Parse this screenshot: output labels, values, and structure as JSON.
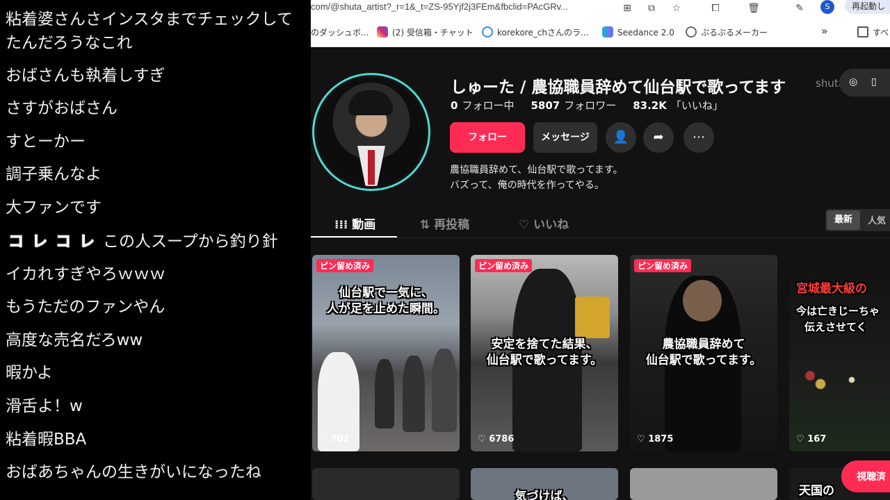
{
  "comments": [
    {
      "text": "粘着婆さんさインスタまでチェックして"
    },
    {
      "text": "たんだろうなこれ"
    },
    {
      "text": "おばさんも執着しすぎ"
    },
    {
      "text": "さすがおばさん"
    },
    {
      "text": "すとーかー"
    },
    {
      "text": "調子乗んなよ"
    },
    {
      "text": "大ファンです"
    },
    {
      "text": "この人スープから釣り針"
    },
    {
      "text": "イカれすぎやろｗｗｗ"
    },
    {
      "text": "もうただのファンやん"
    },
    {
      "text": "高度な売名だろww"
    },
    {
      "text": "暇かよ"
    },
    {
      "text": "滑舌よ！w"
    },
    {
      "text": "粘着暇BBA"
    },
    {
      "text": "おばあちゃんの生きがいになったね"
    }
  ],
  "kore_badge": [
    "コ",
    "レ",
    "コ",
    "レ"
  ],
  "browser": {
    "url": "com/@shuta_artist?_r=1&_t=ZS-95Yjf2j3FEm&fbclid=PAcGRv...",
    "profile_initial": "S",
    "restart_label": "再起動し",
    "bookmarks": [
      {
        "label": "のダッシュボ...",
        "color": "#ffffff"
      },
      {
        "label": "(2) 受信箱・チャット",
        "color": "#e1306c"
      },
      {
        "label": "korekore_chさんのラ...",
        "color": "#3a86ff"
      },
      {
        "label": "Seedance 2.0",
        "color": "#22c1c3"
      },
      {
        "label": "ぷるぷるメーカー",
        "color": "#666666"
      },
      {
        "label": "すべ",
        "color": "#ffffff"
      }
    ]
  },
  "profile": {
    "name": "しゅーた / 農協職員辞めて仙台駅で歌ってます",
    "handle": "shuta_artist",
    "following_count": "0",
    "following_label": "フォロー中",
    "followers_count": "5807",
    "followers_label": "フォロワー",
    "likes_count": "83.2K",
    "likes_label": "「いいね」",
    "follow_label": "フォロー",
    "message_label": "メッセージ",
    "bio_line1": "農協職員辞めて、仙台駅で歌ってます。",
    "bio_line2": "バズって、俺の時代を作ってやる。"
  },
  "tabs": {
    "videos": "動画",
    "reposts": "再投稿",
    "likes": "いいね",
    "sort_latest": "最新",
    "sort_popular": "人気"
  },
  "videos": [
    {
      "pin": "ピン留め済み",
      "caption1": "仙台駅で一気に、",
      "caption2": "人が足を止めた瞬間。",
      "views": "702"
    },
    {
      "pin": "ピン留め済み",
      "caption1": "安定を捨てた結果、",
      "caption2": "仙台駅で歌ってます。",
      "views": "6786"
    },
    {
      "pin": "ピン留め済み",
      "caption1": "農協職員辞めて",
      "caption2": "仙台駅で歌ってます。",
      "views": "1875"
    },
    {
      "pin": "",
      "caption1": "宮城最大級の",
      "caption2": "今は亡きじーちゃ",
      "caption3": "伝えさせてく",
      "views": "167"
    }
  ],
  "row2": {
    "caption_b": "気づけば、",
    "caption_d": "天国の"
  },
  "watched_label": "視聴済"
}
